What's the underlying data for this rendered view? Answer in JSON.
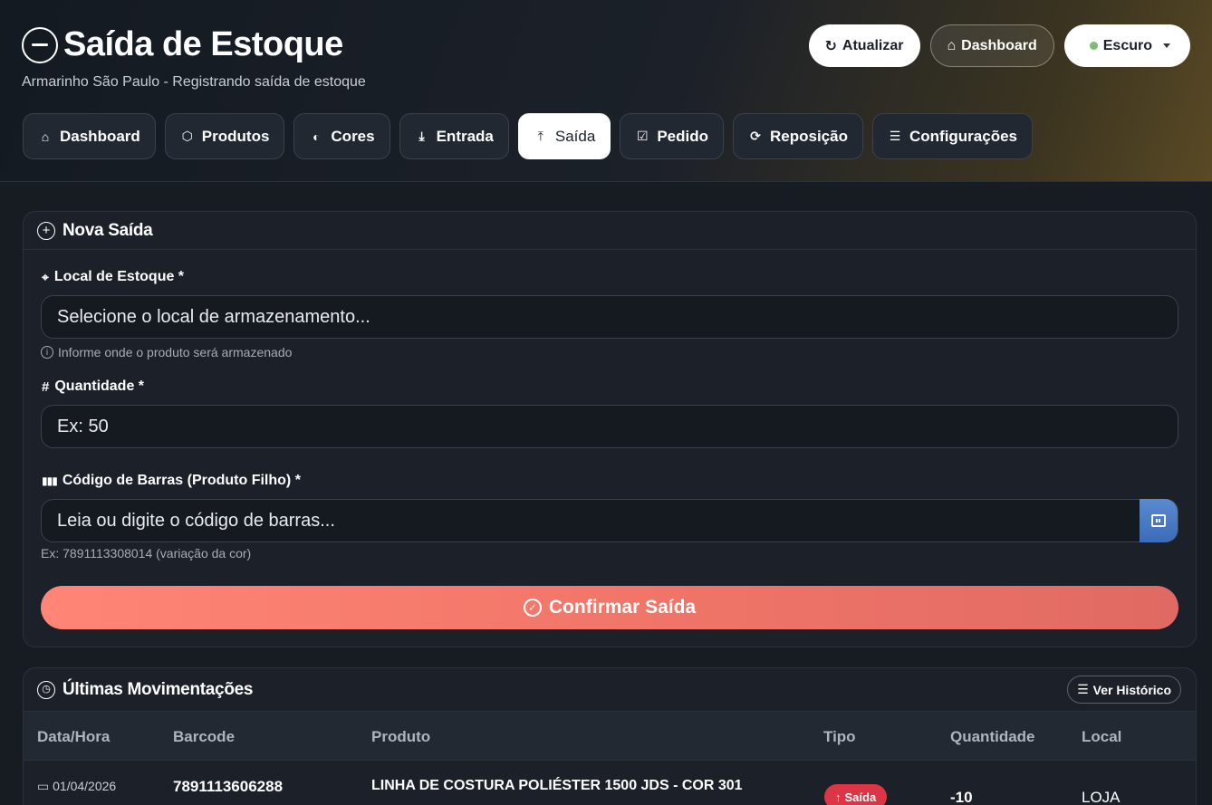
{
  "header": {
    "title": "Saída de Estoque",
    "subtitle": "Armarinho São Paulo - Registrando saída de estoque",
    "actions": {
      "refresh": "Atualizar",
      "dashboard": "Dashboard",
      "theme": "Escuro"
    }
  },
  "nav": {
    "tabs": [
      {
        "label": "Dashboard",
        "icon": "house-icon"
      },
      {
        "label": "Produtos",
        "icon": "box-icon"
      },
      {
        "label": "Cores",
        "icon": "palette-icon"
      },
      {
        "label": "Entrada",
        "icon": "download-icon"
      },
      {
        "label": "Saída",
        "icon": "upload-icon",
        "active": true
      },
      {
        "label": "Pedido",
        "icon": "clipboard-check-icon"
      },
      {
        "label": "Reposição",
        "icon": "refresh-icon"
      },
      {
        "label": "Configurações",
        "icon": "sliders-icon"
      }
    ]
  },
  "form": {
    "title": "Nova Saída",
    "location": {
      "label": "Local de Estoque *",
      "placeholder": "Selecione o local de armazenamento...",
      "hint": "Informe onde o produto será armazenado"
    },
    "quantity": {
      "label": "Quantidade *",
      "placeholder": "Ex: 50"
    },
    "barcode": {
      "label": "Código de Barras (Produto Filho) *",
      "placeholder": "Leia ou digite o código de barras...",
      "hint": "Ex: 7891113308014 (variação da cor)"
    },
    "submit": "Confirmar Saída"
  },
  "movements": {
    "title": "Últimas Movimentações",
    "history_button": "Ver Histórico",
    "columns": [
      "Data/Hora",
      "Barcode",
      "Produto",
      "Tipo",
      "Quantidade",
      "Local"
    ],
    "rows": [
      {
        "date": "01/04/2026",
        "barcode": "7891113606288",
        "product": "LINHA DE COSTURA POLIÉSTER 1500 JDS - COR 301",
        "type": "Saída",
        "quantity": "-10",
        "location": "LOJA"
      }
    ]
  },
  "colors": {
    "accent": "#f07568",
    "danger": "#dc3545",
    "scan": "#4a7cc4"
  }
}
